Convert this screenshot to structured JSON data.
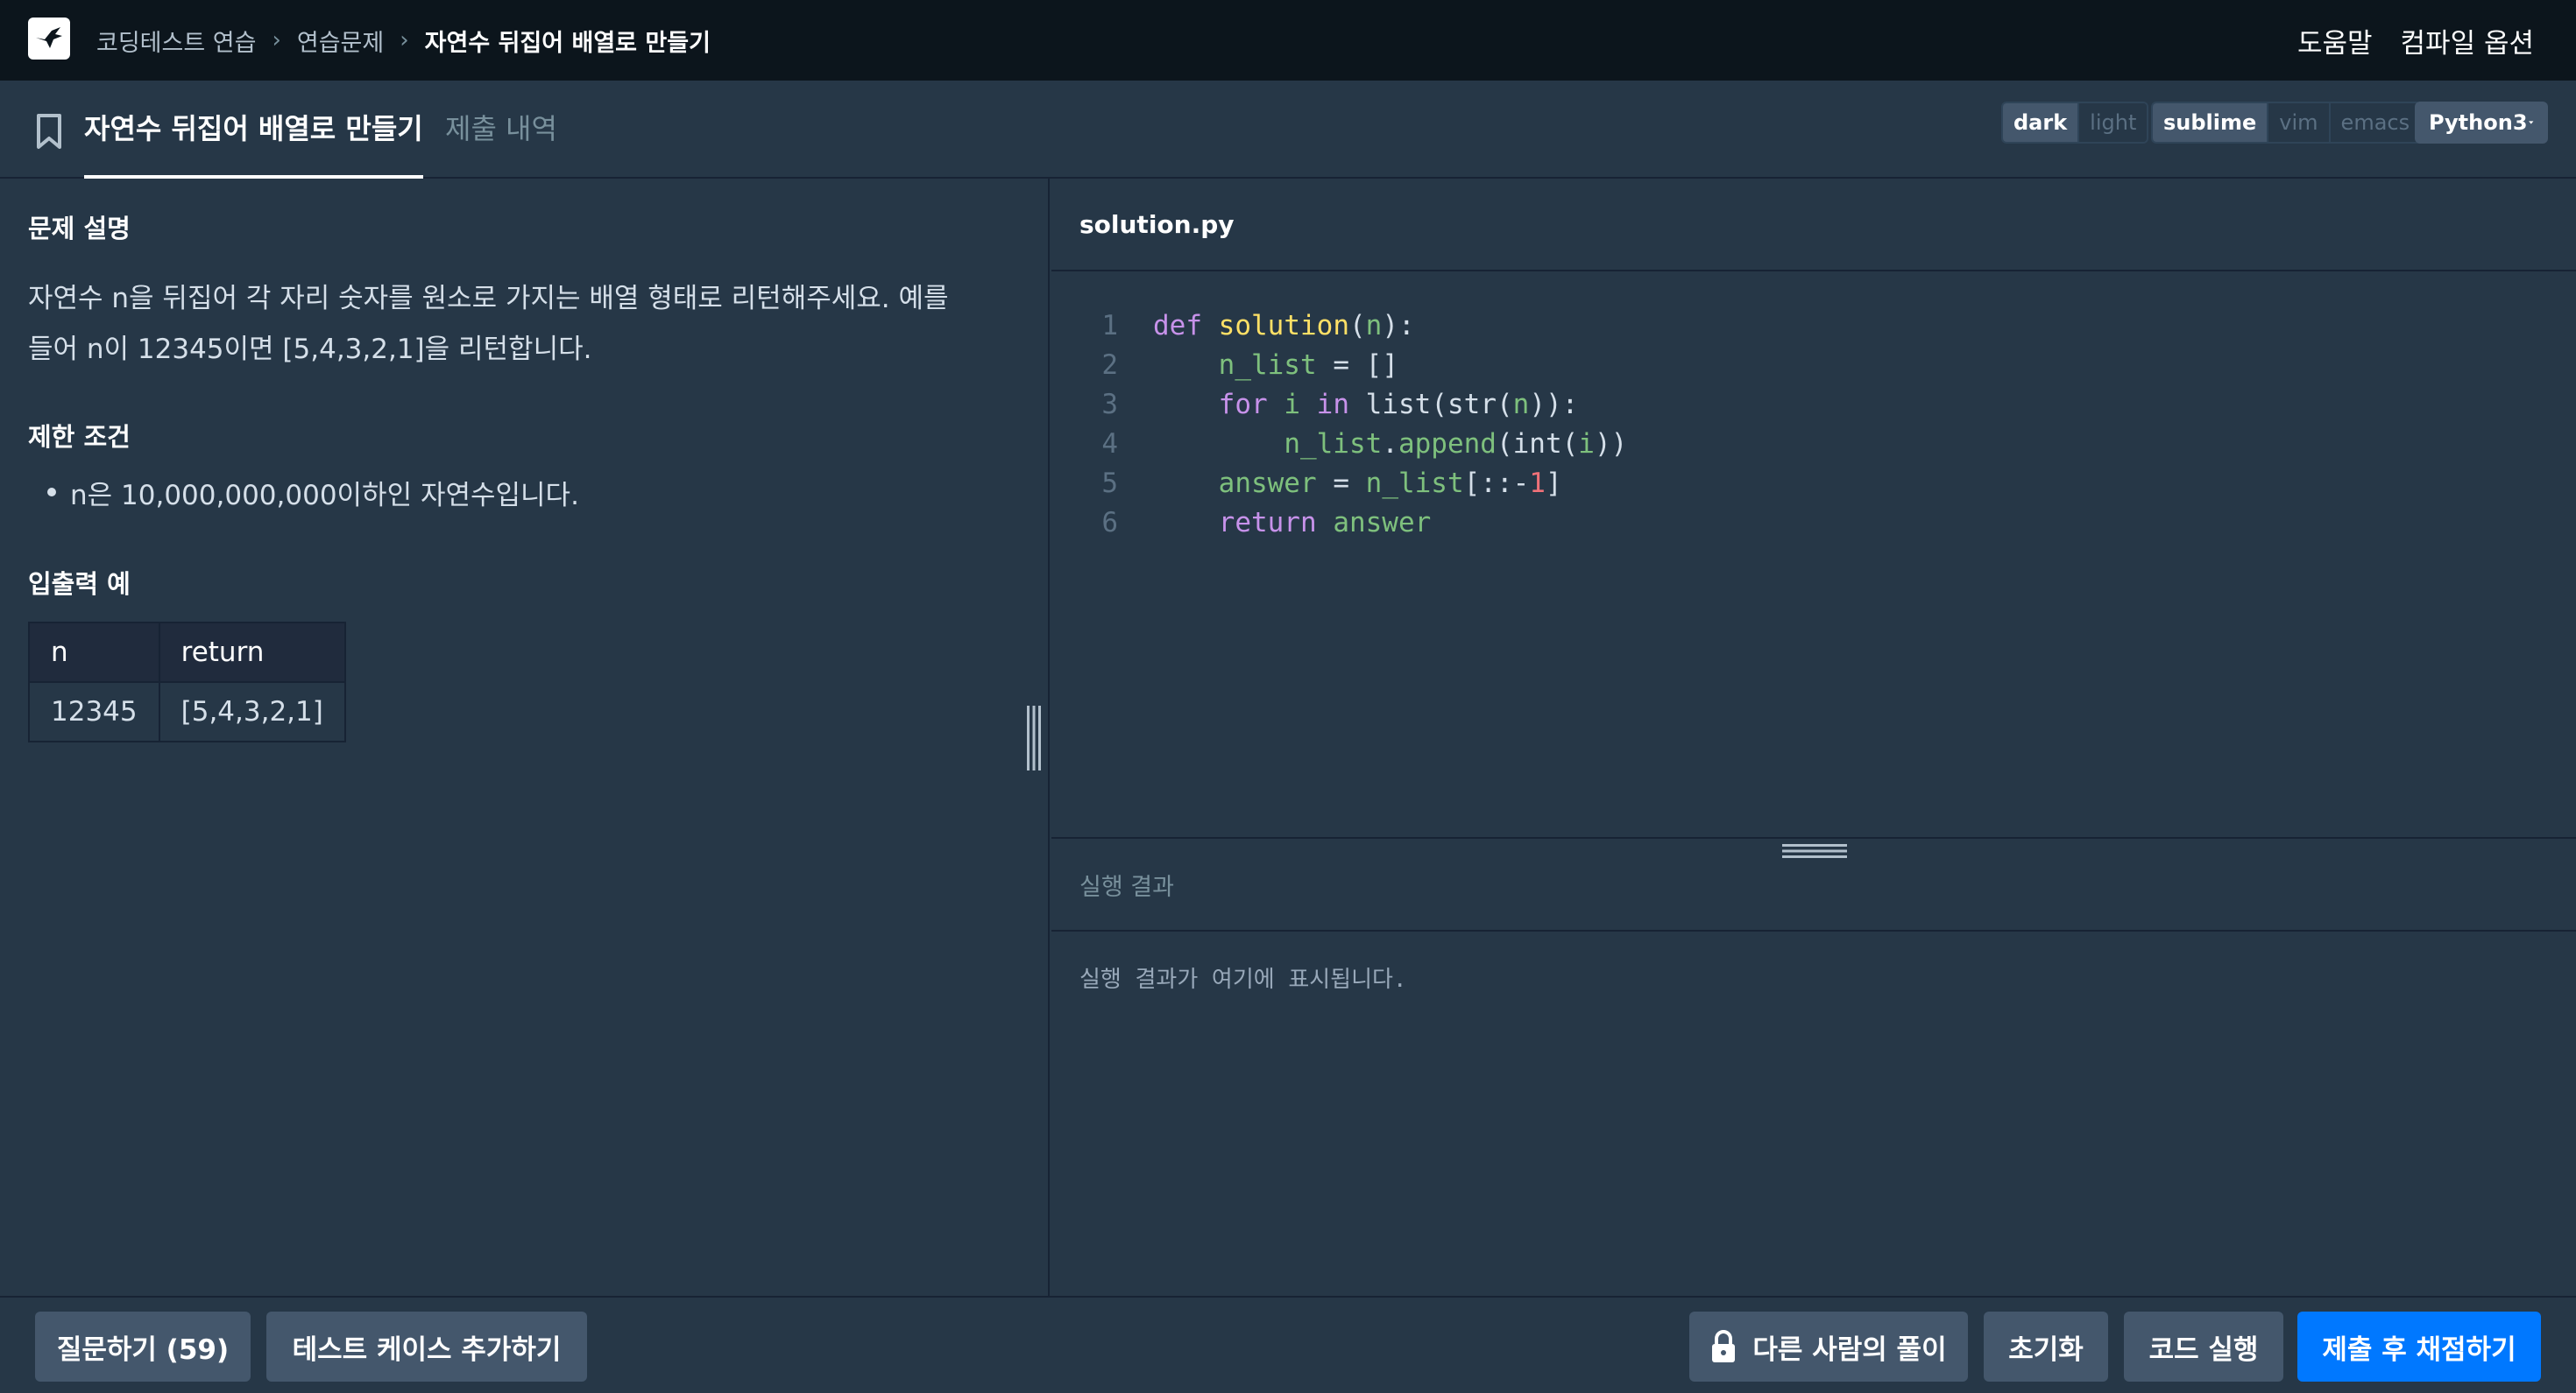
{
  "header": {
    "breadcrumbs": [
      "코딩테스트 연습",
      "연습문제",
      "자연수 뒤집어 배열로 만들기"
    ],
    "breadcrumb_sep": "›",
    "links": [
      "도움말",
      "컴파일 옵션"
    ]
  },
  "tabs": {
    "active": "자연수 뒤집어 배열로 만들기",
    "inactive": "제출 내역"
  },
  "editor_options": {
    "themes": [
      "dark",
      "light"
    ],
    "selected_theme": "dark",
    "keymaps": [
      "sublime",
      "vim",
      "emacs"
    ],
    "selected_keymap": "sublime",
    "language": "Python3"
  },
  "problem": {
    "desc_heading": "문제 설명",
    "desc_line1": "자연수 n을 뒤집어 각 자리 숫자를 원소로 가지는 배열 형태로 리턴해주세요. 예를",
    "desc_line2": "들어 n이 12345이면 [5,4,3,2,1]을 리턴합니다.",
    "limits_heading": "제한 조건",
    "limit_1": "n은 10,000,000,000이하인 자연수입니다.",
    "io_heading": "입출력 예",
    "table_headers": [
      "n",
      "return"
    ],
    "table_rows": [
      [
        "12345",
        "[5,4,3,2,1]"
      ]
    ]
  },
  "editor": {
    "filename": "solution.py",
    "line_numbers": [
      "1",
      "2",
      "3",
      "4",
      "5",
      "6"
    ]
  },
  "result": {
    "heading": "실행 결과",
    "placeholder": "실행 결과가 여기에 표시됩니다."
  },
  "buttons": {
    "ask": "질문하기 (59)",
    "add_testcase": "테스트 케이스 추가하기",
    "others_solution": "다른 사람의 풀이",
    "reset": "초기화",
    "run": "코드 실행",
    "submit": "제출 후 채점하기"
  },
  "colors": {
    "background": "#263747",
    "navbar": "#0C151C",
    "button": "#44576C",
    "primary": "#0078FF"
  }
}
